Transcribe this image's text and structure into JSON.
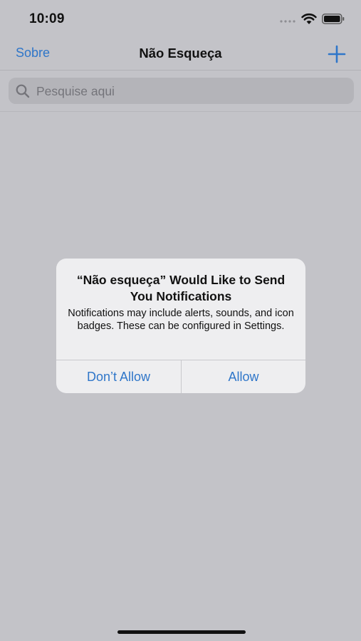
{
  "status_bar": {
    "time": "10:09",
    "icons": [
      "cellular-signal-icon",
      "wifi-icon",
      "battery-icon"
    ]
  },
  "nav": {
    "left_label": "Sobre",
    "title": "Não Esqueça",
    "right_icon": "plus-icon"
  },
  "search": {
    "placeholder": "Pesquise aqui",
    "icon": "search-icon"
  },
  "alert": {
    "title": "“Não esqueça” Would Like to Send You Notifications",
    "message": "Notifications may include alerts, sounds, and icon badges. These can be configured in Settings.",
    "buttons": {
      "deny": "Don’t Allow",
      "allow": "Allow"
    }
  },
  "colors": {
    "accent": "#2f76c9",
    "dimmed_background": "#c3c3c8",
    "alert_background": "#eeeef0"
  }
}
